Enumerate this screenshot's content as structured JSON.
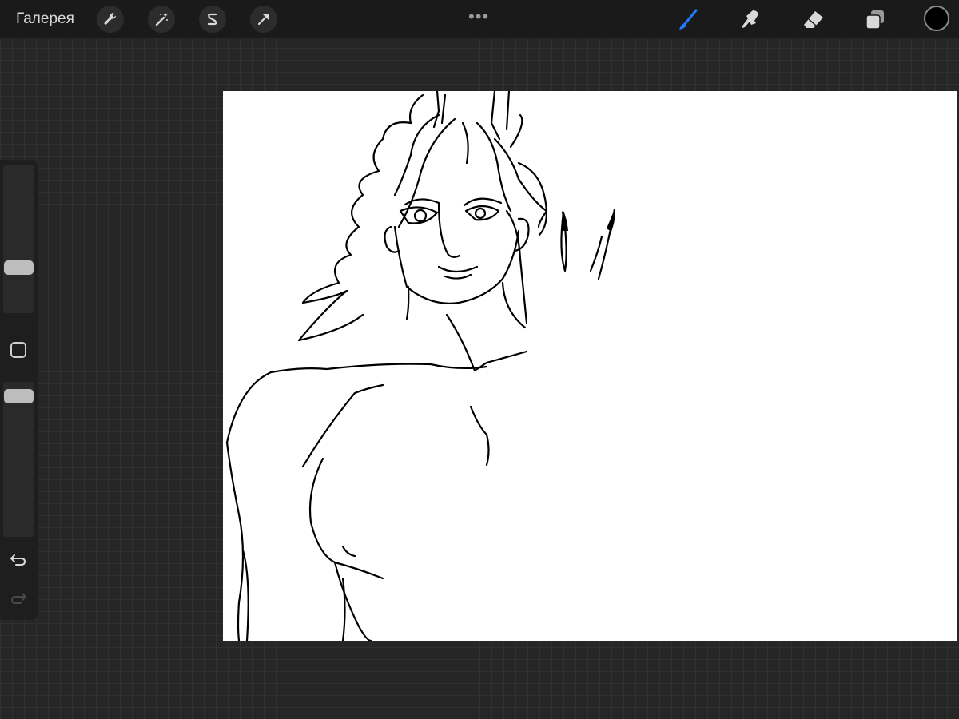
{
  "toolbar": {
    "gallery_label": "Галерея",
    "left_tools": [
      "wrench-icon",
      "magic-wand-icon",
      "selection-s-icon",
      "transform-arrow-icon"
    ],
    "more_dots": "•••",
    "right_tools": [
      "brush-icon",
      "smudge-icon",
      "eraser-icon",
      "layers-icon"
    ],
    "active_tool": "brush",
    "accent_color": "#1e7bff",
    "current_color": "#000000"
  },
  "sidebar": {
    "brush_size_level": 0.45,
    "opacity_level": 0.05,
    "icons": [
      "modify-square-icon",
      "undo-icon",
      "redo-icon"
    ],
    "redo_enabled": false
  },
  "canvas": {
    "background": "#ffffff",
    "content": "line-art-drawing"
  }
}
